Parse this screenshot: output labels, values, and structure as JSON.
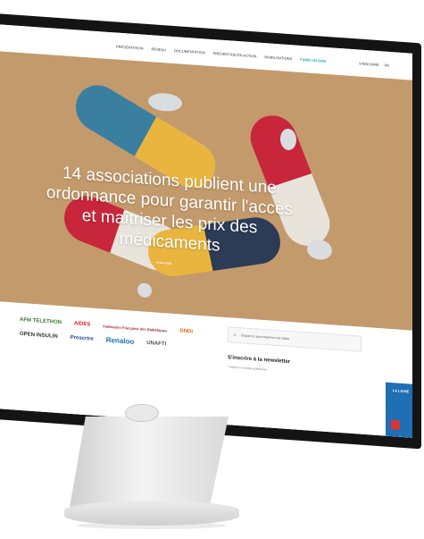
{
  "nav": {
    "items": [
      "PRÉSENTATION",
      "RÉSEAU",
      "DOCUMENTATION",
      "PRÉVENTION EN ACTION",
      "MOBILISATIONS",
      "FAIRE UN DON"
    ],
    "right": [
      "S'INSCRIRE",
      "FR"
    ]
  },
  "hero": {
    "title": "14 associations publient une ordonnance pour garantir l'accès et maîtriser les prix des médicaments",
    "date": "10 MAI 2020"
  },
  "logos": [
    "AFM TELETHON",
    "AIDES",
    "Fédération Française des Diabétiques",
    "DNDi",
    "OPEN INSULIN",
    "Prescrire",
    "Renaloo",
    "UNAFTI"
  ],
  "sidebar": {
    "print_label": "Cliquez ici pour imprimer cet article",
    "newsletter_title": "S'inscrire à la newsletter",
    "newsletter_sub": "* indique les champs obligatoires"
  },
  "side_banner": {
    "label": "LA LIGNE"
  },
  "colors": {
    "hero_bg": "#c39a6b",
    "accent": "#1aa3b9",
    "banner": "#1f6fb5"
  }
}
